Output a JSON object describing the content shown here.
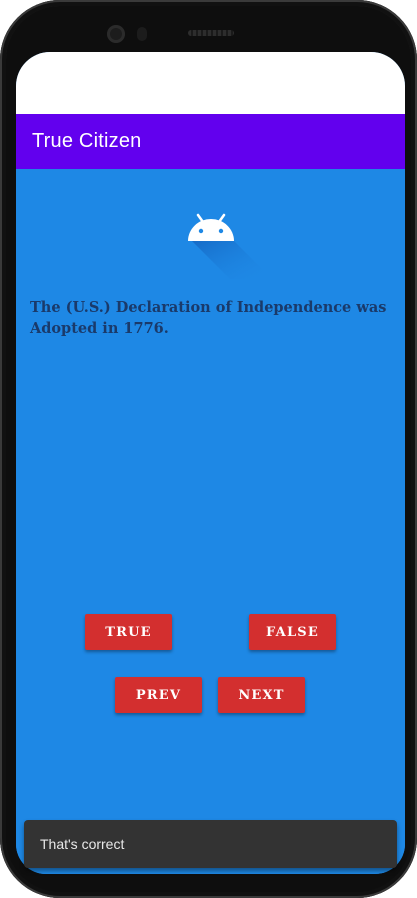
{
  "app": {
    "title": "True Citizen"
  },
  "logo": {
    "icon": "android-icon"
  },
  "question": {
    "text": "The (U.S.) Declaration of Independence was Adopted in 1776."
  },
  "buttons": {
    "true_label": "TRUE",
    "false_label": "FALSE",
    "prev_label": "PREV",
    "next_label": "NEXT"
  },
  "snackbar": {
    "message": "That's correct"
  },
  "colors": {
    "app_bar": "#6200EE",
    "background": "#1E88E5",
    "button": "#D32F2F",
    "question_text": "#1a3a6a",
    "snackbar": "#333333"
  }
}
